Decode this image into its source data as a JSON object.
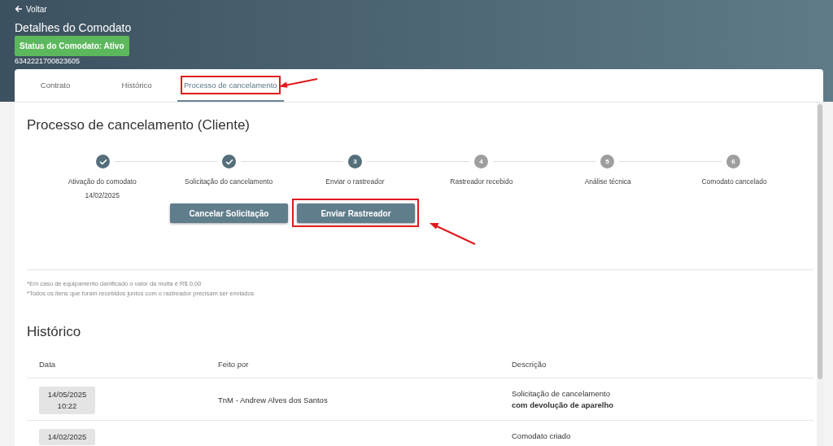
{
  "header": {
    "back_link": "Voltar",
    "title": "Detalhes do Comodato",
    "status_badge": "Status do Comodato: Ativo",
    "contract_number": "6342221700823605"
  },
  "tabs": [
    {
      "label": "Contrato",
      "selected": false,
      "highlighted": false
    },
    {
      "label": "Histórico",
      "selected": false,
      "highlighted": false
    },
    {
      "label": "Processo de cancelamento",
      "selected": true,
      "highlighted": true
    }
  ],
  "process": {
    "title": "Processo de cancelamento (Cliente)",
    "steps": [
      {
        "label": "Ativação do comodato",
        "date": "14/02/2025",
        "completed": true,
        "active": true
      },
      {
        "label": "Solicitação do cancelamento",
        "completed": true,
        "active": true
      },
      {
        "number": "3",
        "label": "Enviar o rastreador",
        "completed": false,
        "active": true
      },
      {
        "number": "4",
        "label": "Rastreador recebido",
        "completed": false,
        "active": false
      },
      {
        "number": "5",
        "label": "Análise técnica",
        "completed": false,
        "active": false
      },
      {
        "number": "6",
        "label": "Comodato cancelado",
        "completed": false,
        "active": false
      }
    ],
    "buttons": [
      {
        "label": "Cancelar Solicitação",
        "highlighted": false
      },
      {
        "label": "Enviar Rastreador",
        "highlighted": true
      }
    ],
    "notes": [
      "*Em caso de equipamento danificado o valor da multa é R$ 0,00",
      "*Todos os itens que foram recebidos juntos com o rastreador precisam ser enviados"
    ]
  },
  "history": {
    "title": "Histórico",
    "columns": [
      "Data",
      "Feito por",
      "Descrição"
    ],
    "rows": [
      {
        "date": [
          "14/05/2025",
          "10:22"
        ],
        "by": "TnM - Andrew Alves dos Santos",
        "description": "Solicitação de cancelamento\n**com devolução de aparelho**"
      },
      {
        "date": [
          "14/02/2025"
        ],
        "description": "Comodato criado"
      }
    ]
  }
}
